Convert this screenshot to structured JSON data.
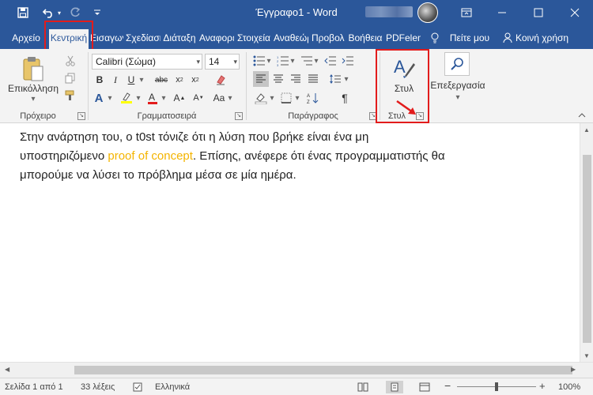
{
  "window": {
    "title": "Έγγραφο1 - Word"
  },
  "tabs": [
    {
      "label": "Αρχείο"
    },
    {
      "label": "Κεντρική"
    },
    {
      "label": "Εισαγωγή"
    },
    {
      "label": "Σχεδίαση"
    },
    {
      "label": "Διάταξη"
    },
    {
      "label": "Αναφορές"
    },
    {
      "label": "Στοιχεία"
    },
    {
      "label": "Αναθεώρηση"
    },
    {
      "label": "Προβολή"
    },
    {
      "label": "Βοήθεια"
    },
    {
      "label": "PDFelement"
    }
  ],
  "tell_me": "Πείτε μου",
  "share": "Κοινή χρήση",
  "clipboard": {
    "paste_label": "Επικόλληση",
    "group_label": "Πρόχειρο"
  },
  "font": {
    "name": "Calibri (Σώμα)",
    "size": "14",
    "group_label": "Γραμματοσειρά"
  },
  "paragraph": {
    "group_label": "Παράγραφος"
  },
  "styles": {
    "button_label": "Στυλ",
    "group_label": "Στυλ"
  },
  "editing": {
    "button_label": "Επεξεργασία"
  },
  "document": {
    "line1": "Στην ανάρτηση του, ο t0st τόνιζε ότι η λύση που βρήκε είναι ένα μη",
    "line2_pre": "υποστηριζόμενο ",
    "line2_accent": "proof of concept",
    "line2_post": ". Επίσης, ανέφερε ότι ένας προγραμματιστής θα",
    "line3": "μπορούμε να λύσει το πρόβλημα μέσα σε μία ημέρα."
  },
  "status": {
    "page": "Σελίδα 1 από 1",
    "words": "33 λέξεις",
    "language": "Ελληνικά",
    "zoom": "100%"
  },
  "colors": {
    "brand": "#2b579a",
    "highlight_box": "#e21c1c",
    "accent_text": "#f4b400"
  }
}
